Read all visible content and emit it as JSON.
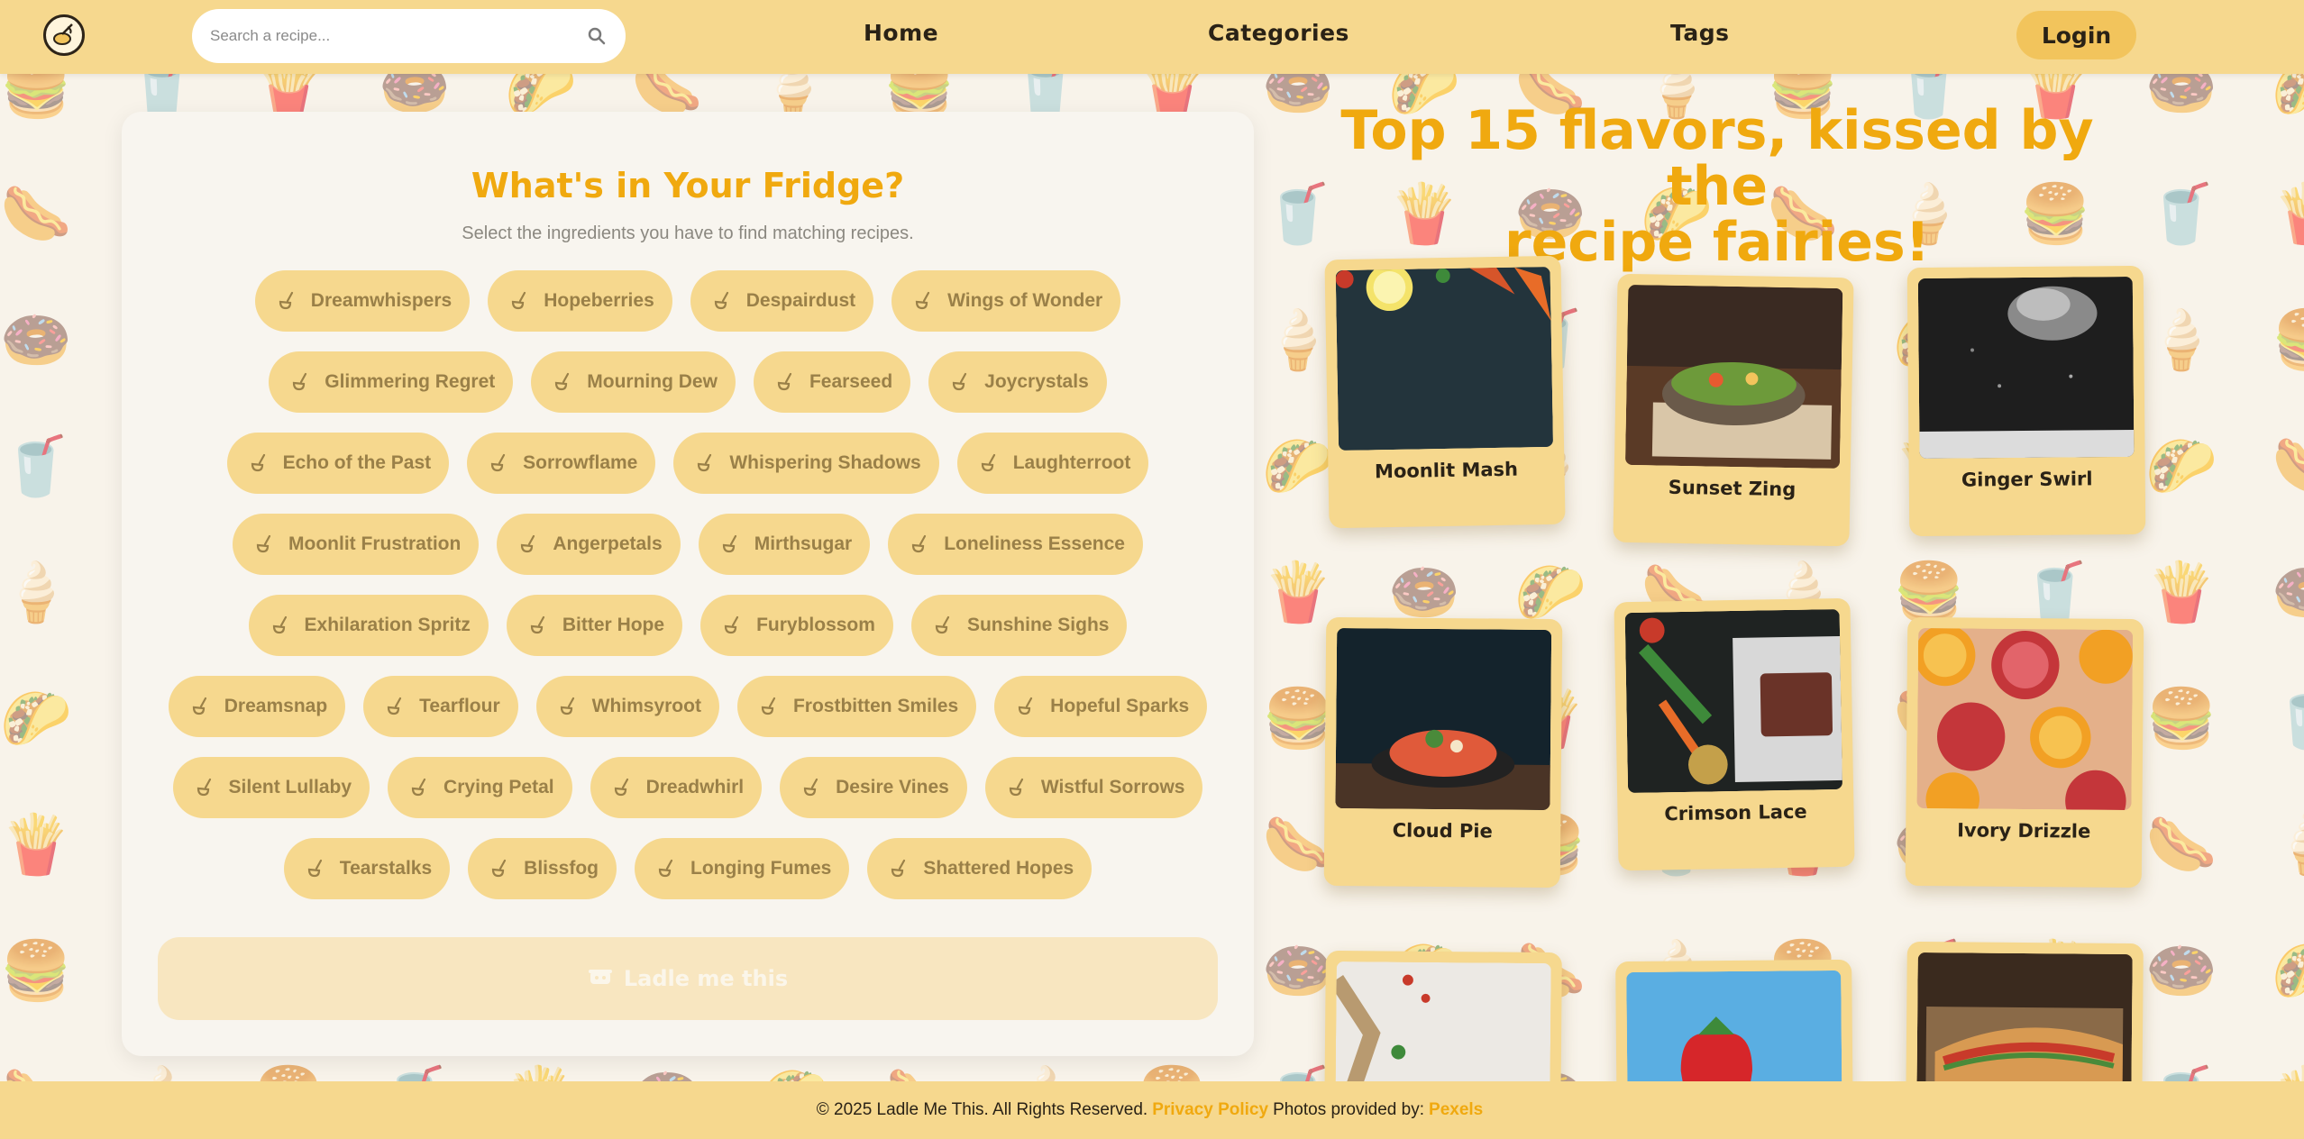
{
  "header": {
    "logo_icon": "chef-whisk-icon",
    "search": {
      "placeholder": "Search a recipe..."
    },
    "nav": [
      {
        "label": "Home"
      },
      {
        "label": "Categories"
      },
      {
        "label": "Tags"
      }
    ],
    "login_label": "Login"
  },
  "fridge": {
    "title": "What's in Your Fridge?",
    "subtitle": "Select the ingredients you have to find matching recipes.",
    "chip_icon": "ladle-icon",
    "rows": [
      [
        "Dreamwhispers",
        "Hopeberries",
        "Despairdust",
        "Wings of Wonder"
      ],
      [
        "Glimmering Regret",
        "Mourning Dew",
        "Fearseed",
        "Joycrystals"
      ],
      [
        "Echo of the Past",
        "Sorrowflame",
        "Whispering Shadows",
        "Laughterroot"
      ],
      [
        "Moonlit Frustration",
        "Angerpetals",
        "Mirthsugar",
        "Loneliness Essence"
      ],
      [
        "Exhilaration Spritz",
        "Bitter Hope",
        "Furyblossom",
        "Sunshine Sighs"
      ],
      [
        "Dreamsnap",
        "Tearflour",
        "Whimsyroot",
        "Frostbitten Smiles",
        "Hopeful Sparks"
      ],
      [
        "Silent Lullaby",
        "Crying Petal",
        "Dreadwhirl",
        "Desire Vines",
        "Wistful Sorrows"
      ],
      [
        "Tearstalks",
        "Blissfog",
        "Longing Fumes",
        "Shattered Hopes"
      ]
    ],
    "button_label": "Ladle me this",
    "button_icon": "pot-icon"
  },
  "top_recipes": {
    "title_line1": "Top 15 flavors, kissed by the",
    "title_line2": "recipe fairies!",
    "cards": [
      {
        "name": "Moonlit Mash",
        "image": "carrots-lemon-dark-board"
      },
      {
        "name": "Sunset Zing",
        "image": "salad-bowl-table"
      },
      {
        "name": "Ginger Swirl",
        "image": "flour-dust-hand"
      },
      {
        "name": "Cloud Pie",
        "image": "tomato-dish-dark-bowl"
      },
      {
        "name": "Crimson Lace",
        "image": "steak-vegetables-sauce"
      },
      {
        "name": "Ivory Drizzle",
        "image": "oranges-pomegranates"
      },
      {
        "name": "",
        "image": "marble-spices-greens"
      },
      {
        "name": "",
        "image": "strawberry-blue-sky"
      },
      {
        "name": "",
        "image": "sub-sandwich-box"
      }
    ]
  },
  "footer": {
    "copyright": "© 2025 Ladle Me This. All Rights Reserved.",
    "privacy_label": "Privacy Policy",
    "photos_text": "Photos provided by:",
    "pexels_label": "Pexels"
  },
  "colors": {
    "header_bg": "#f6d88e",
    "accent": "#f0a90f",
    "chip_bg": "#f6d88e",
    "chip_text": "#9a8048",
    "page_bg": "#f8f3ea"
  }
}
